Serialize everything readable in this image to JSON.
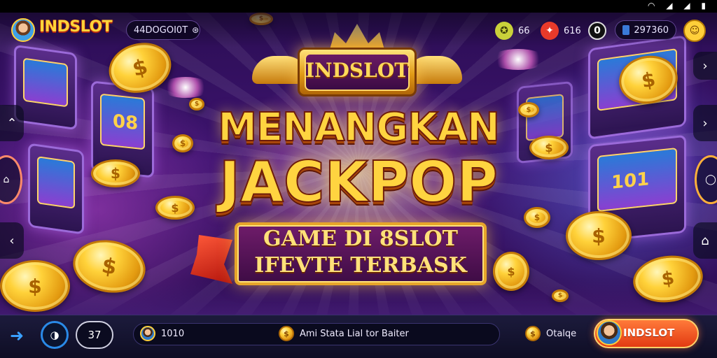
{
  "header": {
    "brand": "INDSLOT",
    "player_id": "44DOGOI0T",
    "stat_1": "66",
    "stat_2": "616",
    "stat_3": "0",
    "balance": "297360"
  },
  "banner": {
    "crest": "INDSLOT",
    "headline_1": "MENANGKAN",
    "headline_2": "JACKPOP",
    "sub_1": "GAME DI 8SLOT",
    "sub_2": "IFEVTE TERBASK"
  },
  "machines": {
    "reel_1": "08",
    "reel_2": "101"
  },
  "bottom": {
    "counter": "37",
    "player_name": "1010",
    "message": "Ami Stata Lial tor Baiter",
    "coin_label": "Otalqe",
    "cta": "INDSLOT"
  },
  "icons": {
    "status": [
      "wifi-icon",
      "signal-icon",
      "signal-icon",
      "battery-icon"
    ],
    "left_side": [
      "chevron-up-icon",
      "home-icon",
      "chevron-left-icon"
    ],
    "right_side": [
      "chevron-right-icon",
      "ring-icon",
      "house-icon"
    ]
  },
  "colors": {
    "gold": "#ffd440",
    "cta": "#e23a12",
    "accent_blue": "#3aa0ff"
  }
}
